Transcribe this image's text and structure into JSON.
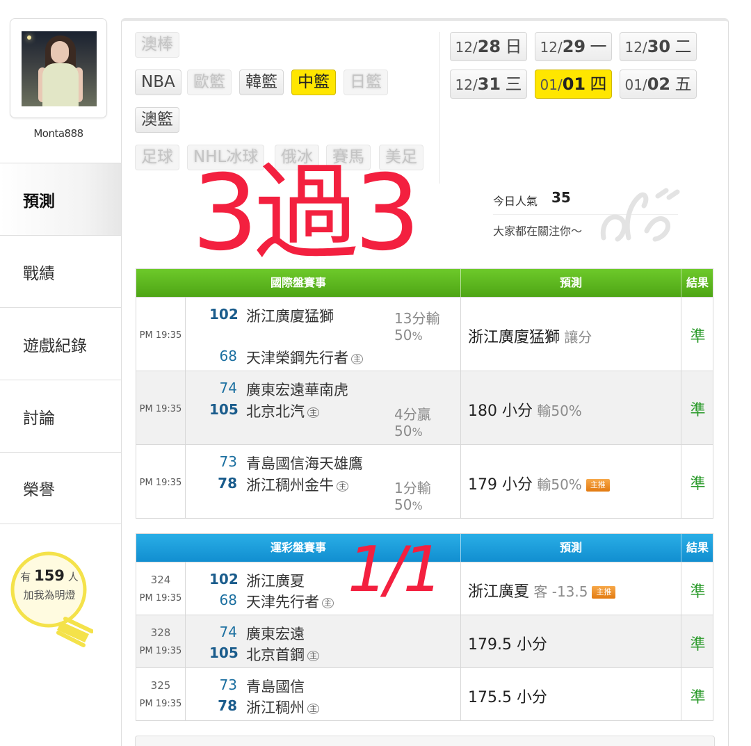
{
  "user": {
    "name": "Monta888"
  },
  "nav": [
    {
      "label": "預測",
      "active": true
    },
    {
      "label": "戰績"
    },
    {
      "label": "遊戲紀錄"
    },
    {
      "label": "討論"
    },
    {
      "label": "榮譽"
    }
  ],
  "fans": {
    "prefix": "有",
    "count": "159",
    "suffix": "人",
    "line2": "加我為明燈"
  },
  "sports": [
    {
      "label": "澳棒",
      "state": "dim"
    },
    {
      "label": "NBA",
      "state": "normal"
    },
    {
      "label": "歐籃",
      "state": "dim"
    },
    {
      "label": "韓籃",
      "state": "normal"
    },
    {
      "label": "中籃",
      "state": "active"
    },
    {
      "label": "日籃",
      "state": "dim"
    },
    {
      "label": "澳籃",
      "state": "normal"
    },
    {
      "label": "足球",
      "state": "dim"
    },
    {
      "label": "NHL冰球",
      "state": "dim"
    },
    {
      "label": "俄冰",
      "state": "dim"
    },
    {
      "label": "賽馬",
      "state": "dim"
    },
    {
      "label": "美足",
      "state": "dim"
    }
  ],
  "dates": [
    {
      "md_prefix": "12/",
      "md_day": "28",
      "weekday": "日"
    },
    {
      "md_prefix": "12/",
      "md_day": "29",
      "weekday": "一"
    },
    {
      "md_prefix": "12/",
      "md_day": "30",
      "weekday": "二"
    },
    {
      "md_prefix": "12/",
      "md_day": "31",
      "weekday": "三"
    },
    {
      "md_prefix": "01/",
      "md_day": "01",
      "weekday": "四",
      "active": true
    },
    {
      "md_prefix": "01/",
      "md_day": "02",
      "weekday": "五"
    }
  ],
  "overlay": {
    "main": "3過3",
    "sub": "1/1"
  },
  "popularity": {
    "label": "今日人氣",
    "value": "35",
    "note": "大家都在關注你〜"
  },
  "intl_table": {
    "headers": {
      "event": "國際盤賽事",
      "prediction": "預測",
      "result": "結果"
    },
    "rows": [
      {
        "time": "PM 19:35",
        "away_score": "102",
        "away_team": "浙江廣廈猛獅",
        "away_win": true,
        "home_score": "68",
        "home_team": "天津榮鋼先行者",
        "home_win": false,
        "home_mark": "主",
        "line_main": "13分輸",
        "line_pct": "50",
        "line_pct_unit": "%",
        "line_row": "top",
        "pick": "浙江廣廈猛獅",
        "pick_extra": "讓分",
        "main_push": false,
        "result": "準"
      },
      {
        "time": "PM 19:35",
        "away_score": "74",
        "away_team": "廣東宏遠華南虎",
        "away_win": false,
        "home_score": "105",
        "home_team": "北京北汽",
        "home_win": true,
        "home_mark": "主",
        "line_main": "4分贏",
        "line_pct": "50",
        "line_pct_unit": "%",
        "line_row": "bottom",
        "pick": "180 小分",
        "pick_extra": "輸50%",
        "main_push": false,
        "result": "準"
      },
      {
        "time": "PM 19:35",
        "away_score": "73",
        "away_team": "青島國信海天雄鷹",
        "away_win": false,
        "home_score": "78",
        "home_team": "浙江稠州金牛",
        "home_win": true,
        "home_mark": "主",
        "line_main": "1分輸",
        "line_pct": "50",
        "line_pct_unit": "%",
        "line_row": "bottom",
        "pick": "179 小分",
        "pick_extra": "輸50%",
        "main_push": true,
        "result": "準"
      }
    ]
  },
  "sportslottery_table": {
    "headers": {
      "event": "運彩盤賽事",
      "prediction": "預測",
      "result": "結果"
    },
    "rows": [
      {
        "game_no": "324",
        "time": "PM 19:35",
        "away_score": "102",
        "away_team": "浙江廣夏",
        "away_win": true,
        "home_score": "68",
        "home_team": "天津先行者",
        "home_win": false,
        "home_mark": "主",
        "pick": "浙江廣夏",
        "pick_extra": "客 -13.5",
        "main_push": true,
        "result": "準"
      },
      {
        "game_no": "328",
        "time": "PM 19:35",
        "away_score": "74",
        "away_team": "廣東宏遠",
        "away_win": false,
        "home_score": "105",
        "home_team": "北京首鋼",
        "home_win": true,
        "home_mark": "主",
        "pick": "179.5 小分",
        "pick_extra": "",
        "main_push": false,
        "result": "準"
      },
      {
        "game_no": "325",
        "time": "PM 19:35",
        "away_score": "73",
        "away_team": "青島國信",
        "away_win": false,
        "home_score": "78",
        "home_team": "浙江稠州",
        "home_win": true,
        "home_mark": "主",
        "pick": "175.5 小分",
        "pick_extra": "",
        "main_push": false,
        "result": "準"
      }
    ]
  },
  "badge_label": "主推",
  "colors": {
    "intl_header": "#55b01c",
    "lottery_header": "#1b9bd9",
    "active_yellow": "#ffe600",
    "overlay_red": "#f3203f",
    "result_green": "#2a9a2a",
    "score_blue": "#1b6fa0"
  }
}
